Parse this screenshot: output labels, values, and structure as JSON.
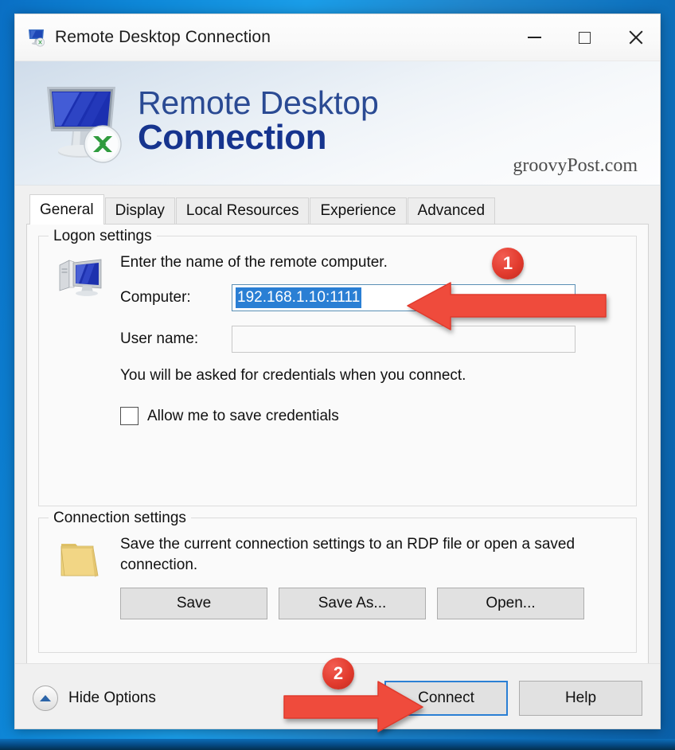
{
  "window": {
    "title": "Remote Desktop Connection",
    "icon": "remote-desktop-icon",
    "controls": {
      "minimize": "Minimize",
      "maximize": "Maximize",
      "close": "Close"
    }
  },
  "banner": {
    "line1": "Remote Desktop",
    "line2": "Connection",
    "watermark": "groovyPost.com",
    "logo_icon": "remote-desktop-logo"
  },
  "tabs": [
    {
      "label": "General",
      "active": true
    },
    {
      "label": "Display",
      "active": false
    },
    {
      "label": "Local Resources",
      "active": false
    },
    {
      "label": "Experience",
      "active": false
    },
    {
      "label": "Advanced",
      "active": false
    }
  ],
  "logon_settings": {
    "group_title": "Logon settings",
    "icon": "computer-icon",
    "prompt": "Enter the name of the remote computer.",
    "computer": {
      "label": "Computer:",
      "value": "192.168.1.10:1111",
      "placeholder": "",
      "selected": true
    },
    "user_name": {
      "label": "User name:",
      "value": "",
      "placeholder": ""
    },
    "credentials_note": "You will be asked for credentials when you connect.",
    "allow_save_credentials": {
      "label": "Allow me to save credentials",
      "checked": false
    }
  },
  "connection_settings": {
    "group_title": "Connection settings",
    "icon": "folder-icon",
    "description": "Save the current connection settings to an RDP file or open a saved connection.",
    "buttons": [
      {
        "label": "Save"
      },
      {
        "label": "Save As..."
      },
      {
        "label": "Open..."
      }
    ]
  },
  "footer": {
    "hide_options": "Hide Options",
    "hide_options_icon": "chevron-up-circle-icon",
    "connect": "Connect",
    "help": "Help"
  },
  "annotations": [
    {
      "badge": "1",
      "target": "computer-field"
    },
    {
      "badge": "2",
      "target": "connect-button"
    }
  ],
  "colors": {
    "desktop_blue": "#0e88d8",
    "banner_title": "#2a4a93",
    "banner_title_bold": "#16348e",
    "selection_blue": "#2a7fd4",
    "annotation_red": "#e23b2e",
    "focus_border": "#2a7fd4"
  }
}
